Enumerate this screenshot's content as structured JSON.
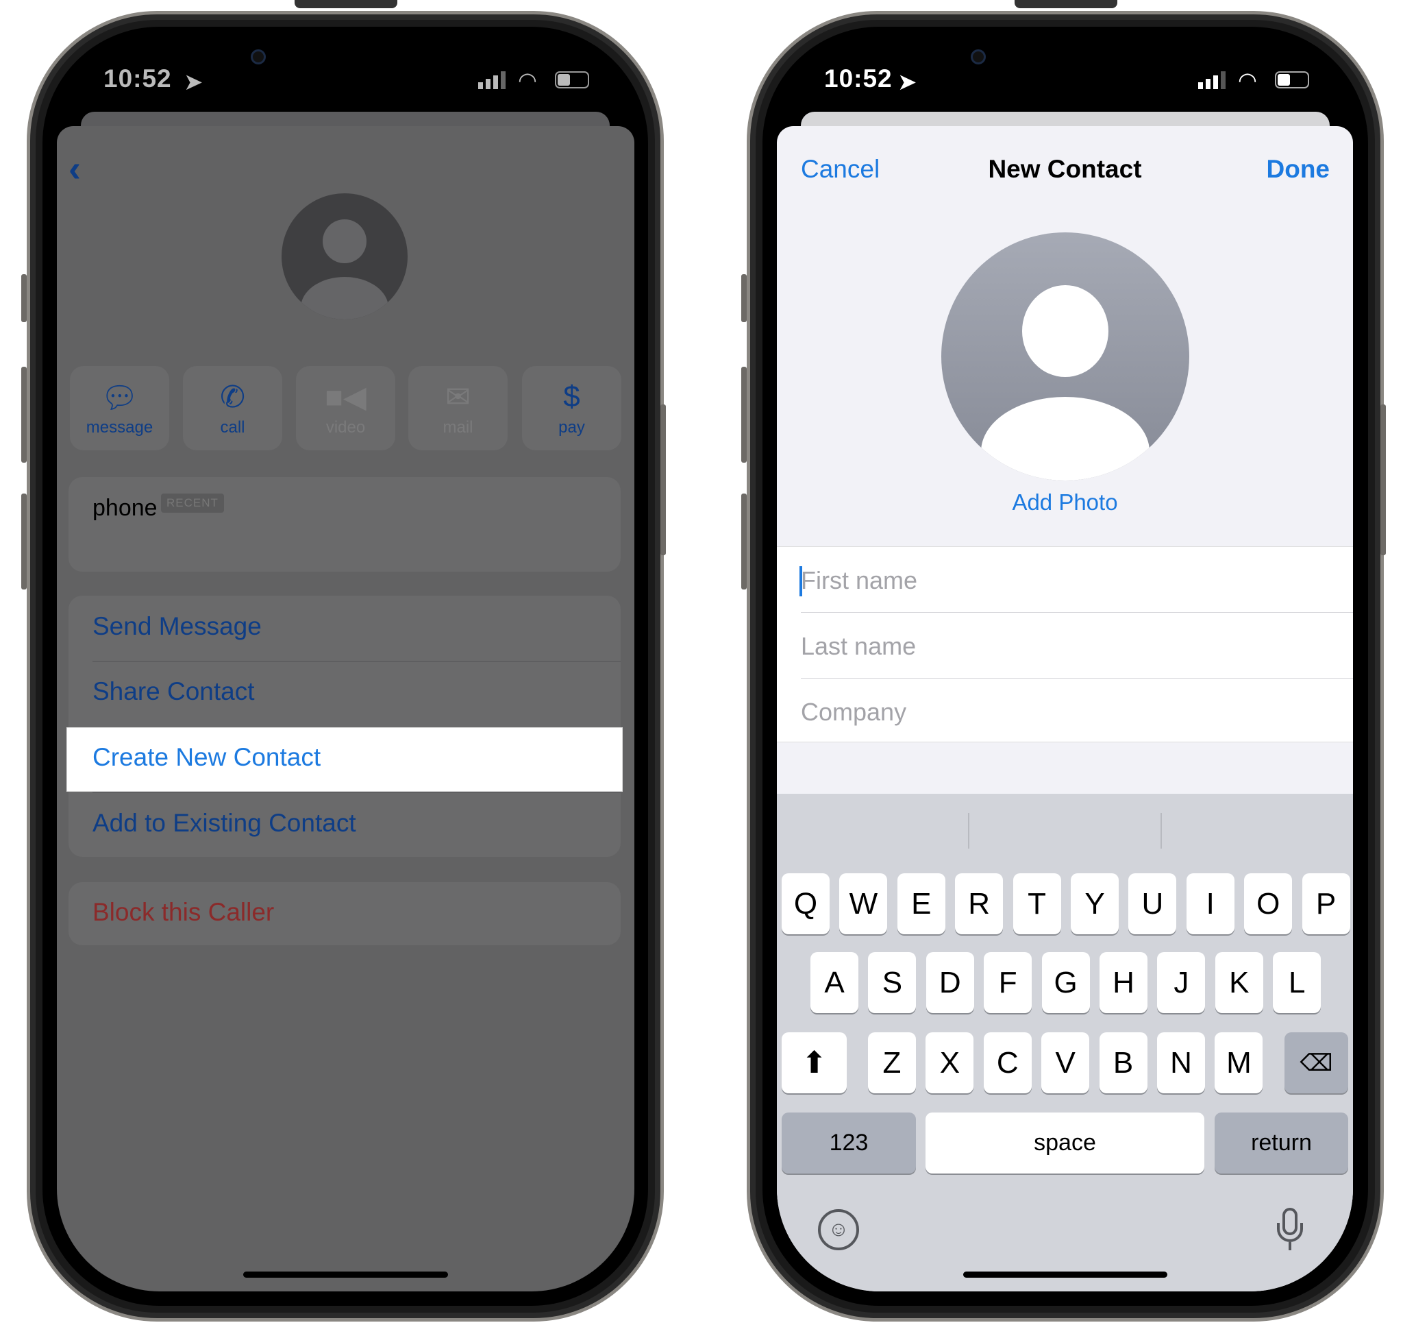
{
  "left": {
    "status": {
      "time": "10:52"
    },
    "actions": [
      {
        "label": "message",
        "icon": "message-bubble-icon",
        "enabled": true
      },
      {
        "label": "call",
        "icon": "phone-icon",
        "enabled": true
      },
      {
        "label": "video",
        "icon": "video-camera-icon",
        "enabled": false
      },
      {
        "label": "mail",
        "icon": "envelope-icon",
        "enabled": false
      },
      {
        "label": "pay",
        "icon": "dollar-icon",
        "enabled": true
      }
    ],
    "phone_label": "phone",
    "recent_badge": "RECENT",
    "menu": [
      "Send Message",
      "Share Contact",
      "Create New Contact",
      "Add to Existing Contact"
    ],
    "highlighted": "Create New Contact",
    "block": "Block this Caller"
  },
  "right": {
    "status": {
      "time": "10:52"
    },
    "nav": {
      "cancel": "Cancel",
      "title": "New Contact",
      "done": "Done"
    },
    "add_photo": "Add Photo",
    "fields": {
      "first": "First name",
      "last": "Last name",
      "company": "Company"
    },
    "keyboard": {
      "row1": [
        "Q",
        "W",
        "E",
        "R",
        "T",
        "Y",
        "U",
        "I",
        "O",
        "P"
      ],
      "row2": [
        "A",
        "S",
        "D",
        "F",
        "G",
        "H",
        "J",
        "K",
        "L"
      ],
      "row3": [
        "Z",
        "X",
        "C",
        "V",
        "B",
        "N",
        "M"
      ],
      "numbers": "123",
      "space": "space",
      "return": "return"
    }
  },
  "colors": {
    "accent": "#1c7ae0",
    "dim_accent": "#0e3d86",
    "destructive_dim": "#8b2a2a"
  }
}
